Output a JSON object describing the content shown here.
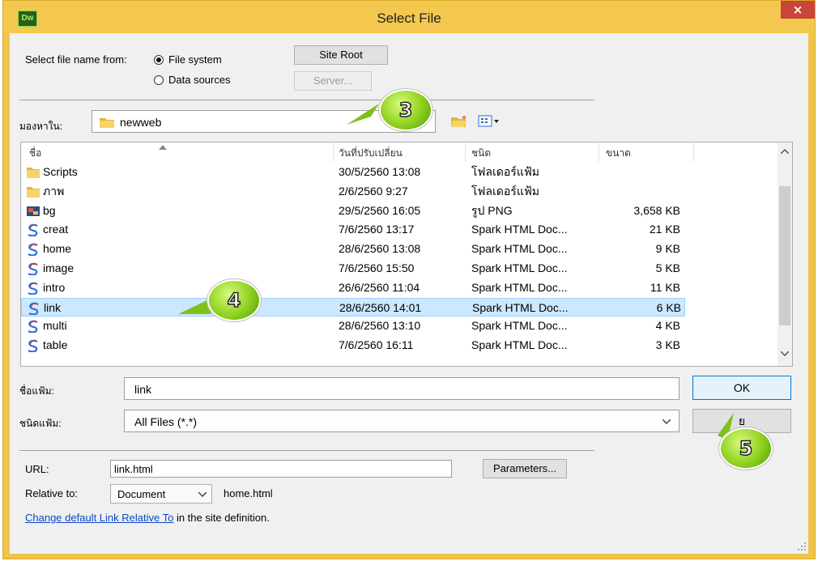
{
  "window": {
    "title": "Select File",
    "logo_text": "Dw",
    "close_glyph": "×"
  },
  "source": {
    "label": "Select file name from:",
    "options": [
      "File system",
      "Data sources"
    ],
    "selected": "File system",
    "site_root_label": "Site Root",
    "server_label": "Server..."
  },
  "lookin": {
    "label": "มองหาใน:",
    "value": "newweb",
    "icons": [
      "folder-up-icon",
      "new-folder-icon",
      "view-menu-icon"
    ]
  },
  "file_list": {
    "columns": [
      "ชื่อ",
      "วันที่ปรับเปลี่ยน",
      "ชนิด",
      "ขนาด"
    ],
    "sort_column": "ชื่อ",
    "rows": [
      {
        "icon": "folder-icon",
        "name": "Scripts",
        "date": "30/5/2560 13:08",
        "type": "โฟลเดอร์แฟ้ม",
        "size": ""
      },
      {
        "icon": "folder-icon",
        "name": "ภาพ",
        "date": "2/6/2560 9:27",
        "type": "โฟลเดอร์แฟ้ม",
        "size": ""
      },
      {
        "icon": "png-image-icon",
        "name": "bg",
        "date": "29/5/2560 16:05",
        "type": "รูป PNG",
        "size": "3,658 KB"
      },
      {
        "icon": "spark-html-icon",
        "name": "creat",
        "date": "7/6/2560 13:17",
        "type": "Spark HTML Doc...",
        "size": "21 KB"
      },
      {
        "icon": "spark-html-icon",
        "name": "home",
        "date": "28/6/2560 13:08",
        "type": "Spark HTML Doc...",
        "size": "9 KB"
      },
      {
        "icon": "spark-html-icon",
        "name": "image",
        "date": "7/6/2560 15:50",
        "type": "Spark HTML Doc...",
        "size": "5 KB"
      },
      {
        "icon": "spark-html-icon",
        "name": "intro",
        "date": "26/6/2560 11:04",
        "type": "Spark HTML Doc...",
        "size": "11 KB"
      },
      {
        "icon": "spark-html-icon",
        "name": "link",
        "date": "28/6/2560 14:01",
        "type": "Spark HTML Doc...",
        "size": "6 KB",
        "selected": true
      },
      {
        "icon": "spark-html-icon",
        "name": "multi",
        "date": "28/6/2560 13:10",
        "type": "Spark HTML Doc...",
        "size": "4 KB"
      },
      {
        "icon": "spark-html-icon",
        "name": "table",
        "date": "7/6/2560 16:11",
        "type": "Spark HTML Doc...",
        "size": "3 KB"
      }
    ]
  },
  "filename": {
    "label": "ชื่อแฟ้ม:",
    "value": "link",
    "ok_label": "OK"
  },
  "filetype": {
    "label": "ชนิดแฟ้ม:",
    "value": "All Files (*.*)",
    "cancel_label": "ย"
  },
  "url": {
    "label": "URL:",
    "value": "link.html",
    "parameters_label": "Parameters..."
  },
  "relative": {
    "label": "Relative to:",
    "value": "Document",
    "file": "home.html"
  },
  "footer": {
    "link_text": "Change default Link Relative To",
    "suffix": " in the site definition."
  },
  "callouts": [
    "3",
    "4",
    "5"
  ],
  "colors": {
    "titlebar": "#f4c84e",
    "close": "#c7453b",
    "selection": "#cce8ff",
    "link": "#0a47c9",
    "callout": "#8ed01e"
  }
}
